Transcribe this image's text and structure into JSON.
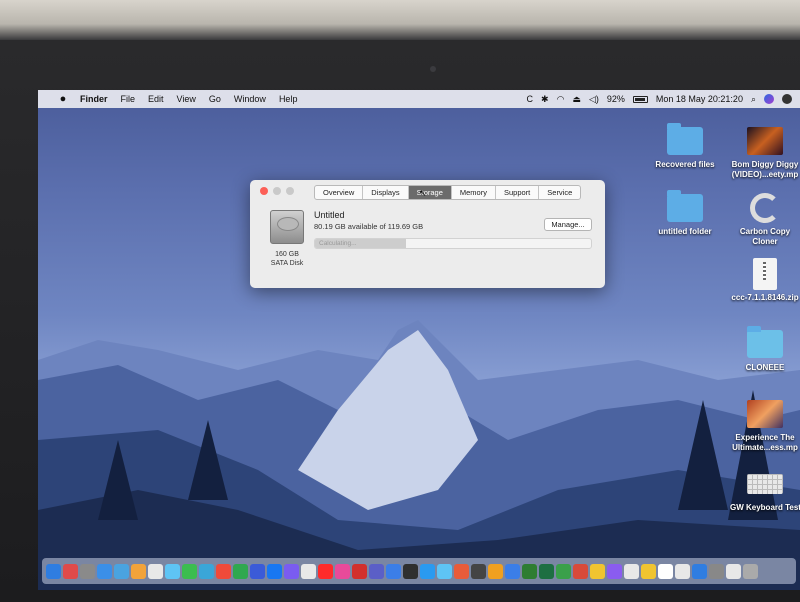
{
  "menubar": {
    "apple": "",
    "items": [
      "Finder",
      "File",
      "Edit",
      "View",
      "Go",
      "Window",
      "Help"
    ],
    "status": {
      "battery_text": "92%",
      "battery_level": 0.92,
      "clock": "Mon 18 May  20:21:20"
    }
  },
  "desktop": {
    "icons": [
      {
        "label": "Recovered files",
        "kind": "folder"
      },
      {
        "label": "Bom Diggy Diggy\n(VIDEO)...eety.mp",
        "kind": "video-thumb"
      },
      {
        "label": "untitled folder",
        "kind": "folder"
      },
      {
        "label": "Carbon Copy\nCloner",
        "kind": "app"
      },
      {
        "label": "ccc-7.1.1.8146.zip",
        "kind": "zip"
      },
      {
        "label": "CLONEEE",
        "kind": "folder"
      },
      {
        "label": "Experience The\nUltimate...ess.mp",
        "kind": "video-thumb"
      },
      {
        "label": "GW Keyboard Test",
        "kind": "keyboard"
      }
    ]
  },
  "about_window": {
    "tabs": [
      "Overview",
      "Displays",
      "Storage",
      "Memory",
      "Support",
      "Service"
    ],
    "active_tab": "Storage",
    "disk": {
      "size_label": "160 GB",
      "type_label": "SATA Disk",
      "volume_name": "Untitled",
      "available_text": "80.19 GB available of 119.69 GB",
      "bar_text": "Calculating...",
      "used_fraction": 0.33
    },
    "manage_label": "Manage..."
  },
  "dock": {
    "colors": [
      "#2f7de1",
      "#e04a4a",
      "#8a8a8a",
      "#3b8fe8",
      "#4aa3e0",
      "#f2a33a",
      "#e8e8e8",
      "#5ec4f5",
      "#3bbd4f",
      "#3aa6d8",
      "#f04a3a",
      "#2fa84f",
      "#3b5bd8",
      "#1877f2",
      "#7a5cf0",
      "#e8e8e8",
      "#ff2b2b",
      "#e84a9a",
      "#d2302c",
      "#5b5fc7",
      "#3b7ee8",
      "#2f2f2f",
      "#2a9af0",
      "#5ec4f5",
      "#e85c3a",
      "#444",
      "#f0a020",
      "#3b7ee8",
      "#2e7d32",
      "#1d6f42",
      "#3aa04a",
      "#d84a3a",
      "#f0c430",
      "#8a5cf0",
      "#e8e8e8",
      "#f0c430",
      "#fff",
      "#e8e8e8",
      "#2f7de1",
      "#888",
      "#e8e8e8",
      "#aaa"
    ]
  }
}
